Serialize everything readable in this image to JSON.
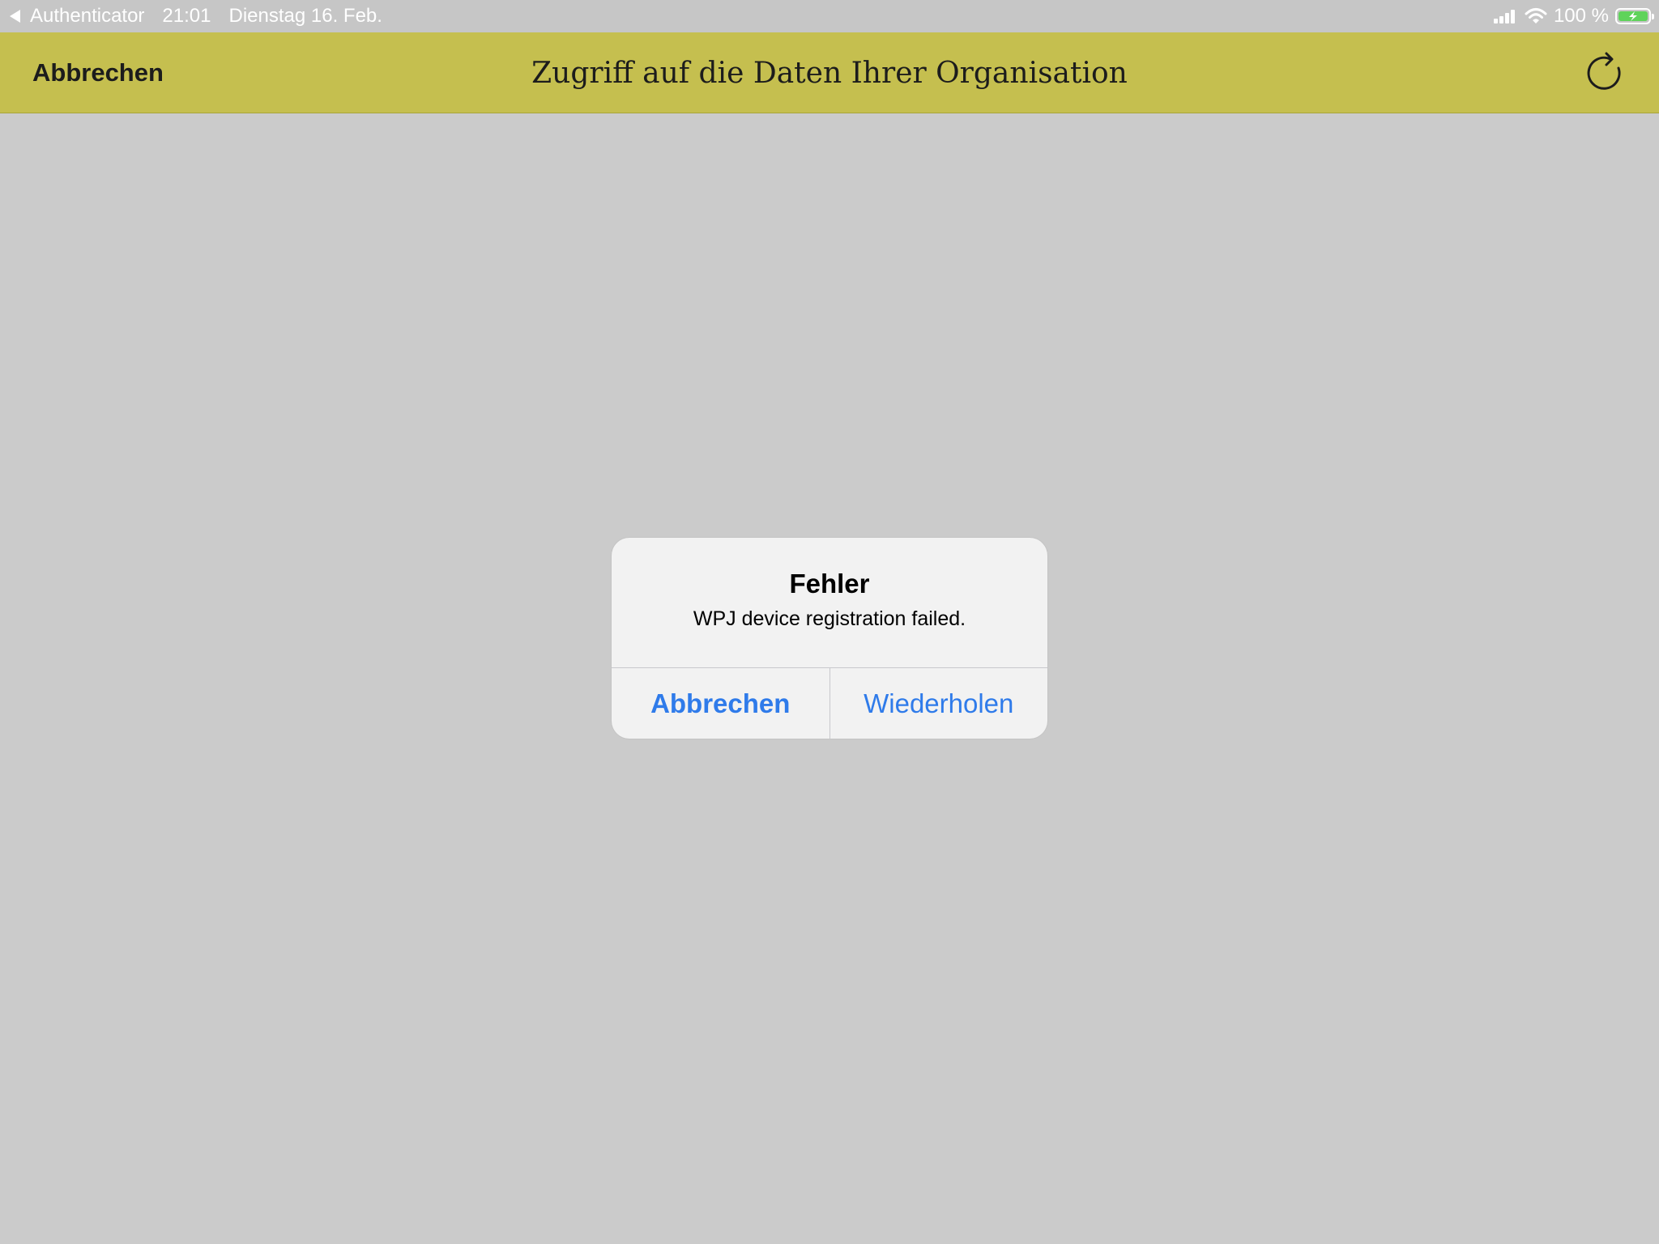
{
  "status_bar": {
    "back_app": "Authenticator",
    "time": "21:01",
    "date": "Dienstag 16. Feb.",
    "battery": "100 %",
    "icons": [
      "back-arrow-icon",
      "signal-icon",
      "wifi-icon",
      "battery-charging-icon"
    ]
  },
  "nav": {
    "cancel_label": "Abbrechen",
    "title": "Zugriff auf die Daten Ihrer Organisation",
    "refresh_icon": "refresh-icon"
  },
  "alert": {
    "title": "Fehler",
    "message": "WPJ device registration failed.",
    "buttons": {
      "cancel": "Abbrechen",
      "retry": "Wiederholen"
    }
  },
  "colors": {
    "nav_background": "#c5bf4f",
    "screen_background": "#cbcbcb",
    "status_bar_background": "#c6c6c6",
    "alert_background": "#f2f2f2",
    "accent_blue": "#2f7bea",
    "battery_green": "#5fd35b"
  }
}
